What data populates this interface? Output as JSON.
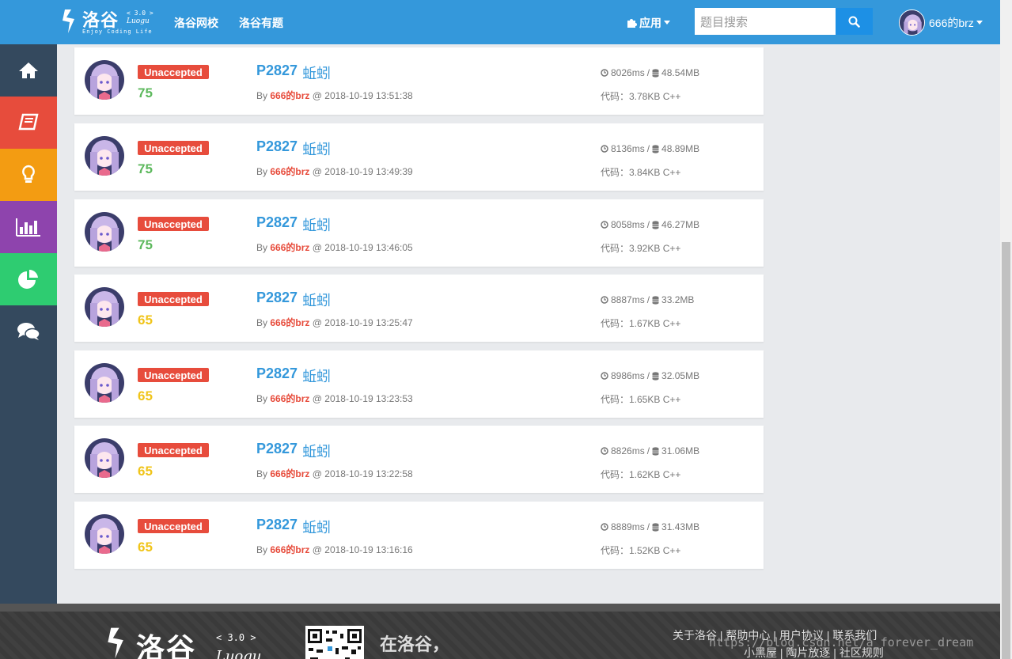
{
  "navbar": {
    "logo_text": "洛谷",
    "logo_version": "< 3.0 >",
    "logo_luogu": "Luogu",
    "logo_slogan": "Enjoy Coding Life",
    "links": [
      "洛谷网校",
      "洛谷有题"
    ],
    "app_menu_label": "应用",
    "search_placeholder": "题目搜索",
    "username": "666的brz",
    "accent_color": "#3498db"
  },
  "sidebar": {
    "items": [
      {
        "icon": "home-icon",
        "color": "#34495e"
      },
      {
        "icon": "book-icon",
        "color": "#e74c3c"
      },
      {
        "icon": "lightbulb-icon",
        "color": "#f39c12"
      },
      {
        "icon": "bar-chart-icon",
        "color": "#8e44ad"
      },
      {
        "icon": "pie-chart-icon",
        "color": "#2ecc71"
      },
      {
        "icon": "comments-icon",
        "color": "#34495e"
      }
    ]
  },
  "records": [
    {
      "status": "Unaccepted",
      "score": "75",
      "score_color": "#5cb85c",
      "problem_id": "P2827",
      "problem_name": "蚯蚓",
      "user": "666的brz",
      "time": "2018-10-19 13:51:38",
      "runtime": "8026ms",
      "memory": "48.54MB",
      "code": "代码：3.78KB C++"
    },
    {
      "status": "Unaccepted",
      "score": "75",
      "score_color": "#5cb85c",
      "problem_id": "P2827",
      "problem_name": "蚯蚓",
      "user": "666的brz",
      "time": "2018-10-19 13:49:39",
      "runtime": "8136ms",
      "memory": "48.89MB",
      "code": "代码：3.84KB C++"
    },
    {
      "status": "Unaccepted",
      "score": "75",
      "score_color": "#5cb85c",
      "problem_id": "P2827",
      "problem_name": "蚯蚓",
      "user": "666的brz",
      "time": "2018-10-19 13:46:05",
      "runtime": "8058ms",
      "memory": "46.27MB",
      "code": "代码：3.92KB C++"
    },
    {
      "status": "Unaccepted",
      "score": "65",
      "score_color": "#f0c419",
      "problem_id": "P2827",
      "problem_name": "蚯蚓",
      "user": "666的brz",
      "time": "2018-10-19 13:25:47",
      "runtime": "8887ms",
      "memory": "33.2MB",
      "code": "代码：1.67KB C++"
    },
    {
      "status": "Unaccepted",
      "score": "65",
      "score_color": "#f0c419",
      "problem_id": "P2827",
      "problem_name": "蚯蚓",
      "user": "666的brz",
      "time": "2018-10-19 13:23:53",
      "runtime": "8986ms",
      "memory": "32.05MB",
      "code": "代码：1.65KB C++"
    },
    {
      "status": "Unaccepted",
      "score": "65",
      "score_color": "#f0c419",
      "problem_id": "P2827",
      "problem_name": "蚯蚓",
      "user": "666的brz",
      "time": "2018-10-19 13:22:58",
      "runtime": "8826ms",
      "memory": "31.06MB",
      "code": "代码：1.62KB C++"
    },
    {
      "status": "Unaccepted",
      "score": "65",
      "score_color": "#f0c419",
      "problem_id": "P2827",
      "problem_name": "蚯蚓",
      "user": "666的brz",
      "time": "2018-10-19 13:16:16",
      "runtime": "8889ms",
      "memory": "31.43MB",
      "code": "代码：1.52KB C++"
    }
  ],
  "labels": {
    "by": "By",
    "at": "@",
    "sep": "/"
  },
  "footer": {
    "logo_text": "洛谷",
    "version": "< 3.0 >",
    "luogu": "Luogu",
    "slogan": "在洛谷，",
    "links_row1": "关于洛谷 | 帮助中心 | 用户协议 | 联系我们",
    "links_row2": "小黑屋 | 陶片放逐 | 社区规则"
  },
  "watermark": "https://blog.csdn.net/a_forever_dream"
}
